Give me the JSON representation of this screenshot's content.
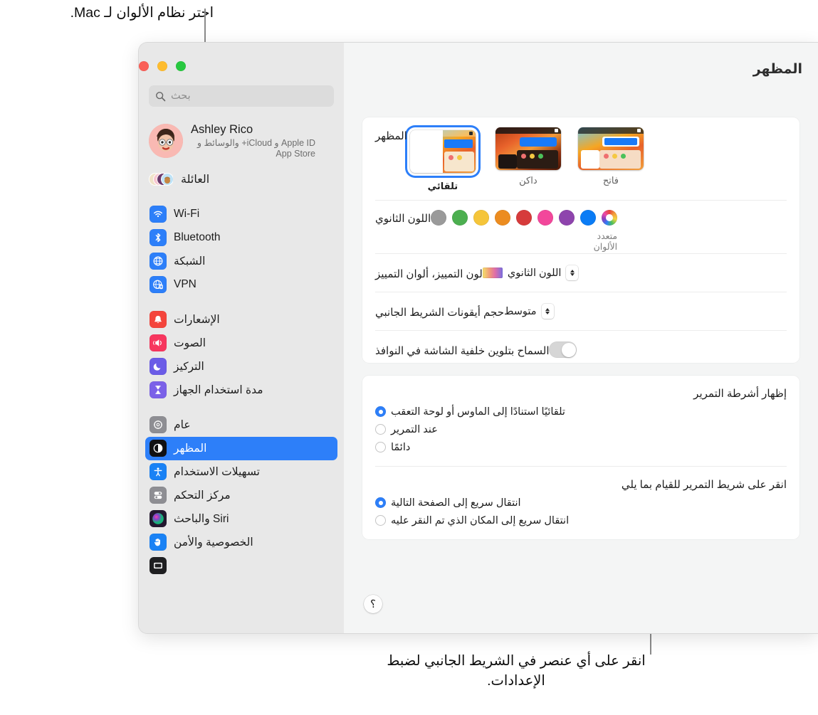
{
  "callouts": {
    "top": "اختر نظام الألوان لـ Mac.",
    "bottom": "انقر على أي عنصر في الشريط الجانبي لضبط الإعدادات."
  },
  "window": {
    "title": "المظهر",
    "traffic_lights": [
      "close-red",
      "minimize-yellow",
      "zoom-green"
    ],
    "help_label": "؟"
  },
  "sidebar": {
    "search": {
      "placeholder": "بحث",
      "icon": "search-icon"
    },
    "account": {
      "name": "Ashley Rico",
      "subtitle": "Apple ID و iCloud+ والوسائط و App Store"
    },
    "family": {
      "label": "العائلة"
    },
    "groups": [
      {
        "items": [
          {
            "label": "Wi-Fi",
            "icon": "wifi-icon",
            "color": "#2d7ff9",
            "selected": false
          },
          {
            "label": "Bluetooth",
            "icon": "bluetooth-icon",
            "color": "#2d7ff9",
            "selected": false
          },
          {
            "label": "الشبكة",
            "icon": "globe-icon",
            "color": "#2d7ff9",
            "selected": false
          },
          {
            "label": "VPN",
            "icon": "vpn-globe-icon",
            "color": "#2d7ff9",
            "selected": false
          }
        ]
      },
      {
        "items": [
          {
            "label": "الإشعارات",
            "icon": "bell-icon",
            "color": "#f4453c",
            "selected": false
          },
          {
            "label": "الصوت",
            "icon": "speaker-icon",
            "color": "#f7365e",
            "selected": false
          },
          {
            "label": "التركيز",
            "icon": "moon-icon",
            "color": "#6b5ce7",
            "selected": false
          },
          {
            "label": "مدة استخدام الجهاز",
            "icon": "hourglass-icon",
            "color": "#7b61e8",
            "selected": false
          }
        ]
      },
      {
        "items": [
          {
            "label": "عام",
            "icon": "gear-icon",
            "color": "#8e8e93",
            "selected": false
          },
          {
            "label": "المظهر",
            "icon": "appearance-icon",
            "color": "#1c1c1e",
            "selected": true
          },
          {
            "label": "تسهيلات الاستخدام",
            "icon": "accessibility-icon",
            "color": "#1a82f5",
            "selected": false
          },
          {
            "label": "مركز التحكم",
            "icon": "control-center-icon",
            "color": "#8e8e93",
            "selected": false
          },
          {
            "label": "Siri والباحث",
            "icon": "siri-icon",
            "color": "#2b1b3a",
            "selected": false
          },
          {
            "label": "الخصوصية والأمن",
            "icon": "hand-icon",
            "color": "#1a82f5",
            "selected": false
          }
        ]
      }
    ]
  },
  "main": {
    "appearance": {
      "label": "المظهر",
      "options": [
        {
          "value": "تلقائي",
          "selected": true
        },
        {
          "value": "داكن",
          "selected": false
        },
        {
          "value": "فاتح",
          "selected": false
        }
      ]
    },
    "accent": {
      "label": "اللون الثانوي",
      "multicolor_label": "متعدد الألوان",
      "swatches": [
        {
          "name": "multicolor",
          "color": "multi",
          "selected": false
        },
        {
          "name": "blue",
          "color": "#0b7cf5",
          "selected": false
        },
        {
          "name": "purple",
          "color": "#8e44ad",
          "selected": false
        },
        {
          "name": "pink",
          "color": "#f2479b",
          "selected": false
        },
        {
          "name": "red",
          "color": "#d63b3b",
          "selected": false
        },
        {
          "name": "orange",
          "color": "#ec8c20",
          "selected": false
        },
        {
          "name": "yellow",
          "color": "#f5c53a",
          "selected": false
        },
        {
          "name": "green",
          "color": "#4caf50",
          "selected": false
        },
        {
          "name": "graphite",
          "color": "#9a9a9a",
          "selected": false
        }
      ]
    },
    "highlight": {
      "label": "لون التمييز، ألوان التمييز",
      "value": "اللون الثانوي"
    },
    "sidebar_icon_size": {
      "label": "حجم أيقونات الشريط الجانبي",
      "value": "متوسط"
    },
    "wallpaper_tinting": {
      "label": "السماح بتلوين خلفية الشاشة في النوافذ",
      "enabled": false
    },
    "show_scroll_bars": {
      "title": "إظهار أشرطة التمرير",
      "options": [
        {
          "label": "تلقائيًا استنادًا إلى الماوس أو لوحة التعقب",
          "selected": true
        },
        {
          "label": "عند التمرير",
          "selected": false
        },
        {
          "label": "دائمًا",
          "selected": false
        }
      ]
    },
    "click_scroll_bar": {
      "title": "انقر على شريط التمرير للقيام بما يلي",
      "options": [
        {
          "label": "انتقال سريع إلى الصفحة التالية",
          "selected": true
        },
        {
          "label": "انتقال سريع إلى المكان الذي تم النقر عليه",
          "selected": false
        }
      ]
    }
  },
  "colors": {
    "accent_blue": "#2d7ff9",
    "sidebar_bg": "#e8e8e8",
    "content_bg": "#f4f5f5",
    "card_bg": "#ffffff"
  }
}
